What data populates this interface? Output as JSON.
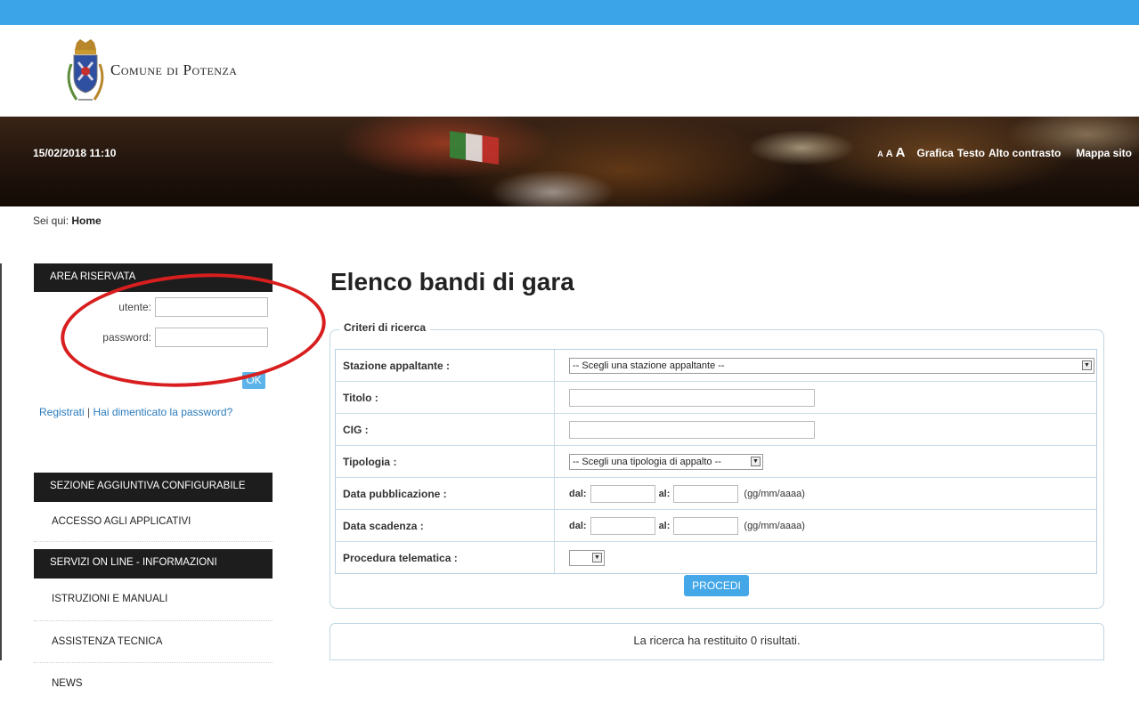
{
  "header": {
    "logo_text": "Comune di Potenza"
  },
  "banner": {
    "datetime": "15/02/2018 11:10",
    "font_sizes": [
      "A",
      "A",
      "A"
    ],
    "links": [
      "Grafica",
      "Testo",
      "Alto contrasto",
      "Mappa sito"
    ]
  },
  "breadcrumb": {
    "prefix": "Sei qui:",
    "current": "Home"
  },
  "sidebar": {
    "area_title": "AREA RISERVATA",
    "user_label": "utente:",
    "password_label": "password:",
    "ok_label": "OK",
    "register": "Registrati",
    "separator": "|",
    "forgot": "Hai dimenticato la password?",
    "section1_title": "SEZIONE AGGIUNTIVA CONFIGURABILE",
    "section1_items": [
      "ACCESSO AGLI APPLICATIVI"
    ],
    "section2_title": "SERVIZI ON LINE - INFORMAZIONI",
    "section2_items": [
      "ISTRUZIONI E MANUALI",
      "ASSISTENZA TECNICA",
      "NEWS"
    ]
  },
  "main": {
    "title": "Elenco bandi di gara",
    "legend": "Criteri di ricerca",
    "rows": {
      "stazione": {
        "label": "Stazione appaltante :",
        "value": "-- Scegli una stazione appaltante --"
      },
      "titolo": {
        "label": "Titolo :"
      },
      "cig": {
        "label": "CIG :"
      },
      "tipologia": {
        "label": "Tipologia :",
        "value": "-- Scegli una tipologia di appalto --"
      },
      "pubblicazione": {
        "label": "Data pubblicazione :"
      },
      "scadenza": {
        "label": "Data scadenza :"
      },
      "telematica": {
        "label": "Procedura telematica :",
        "value": ""
      }
    },
    "dal_label": "dal:",
    "al_label": "al:",
    "date_hint": "(gg/mm/aaaa)",
    "submit": "PROCEDI",
    "result": "La ricerca ha restituito 0 risultati."
  },
  "colors": {
    "topbar": "#3ba4e8",
    "button": "#43a7e8",
    "annotation": "#d81e1e",
    "sidebar_header": "#1d1d1d"
  }
}
